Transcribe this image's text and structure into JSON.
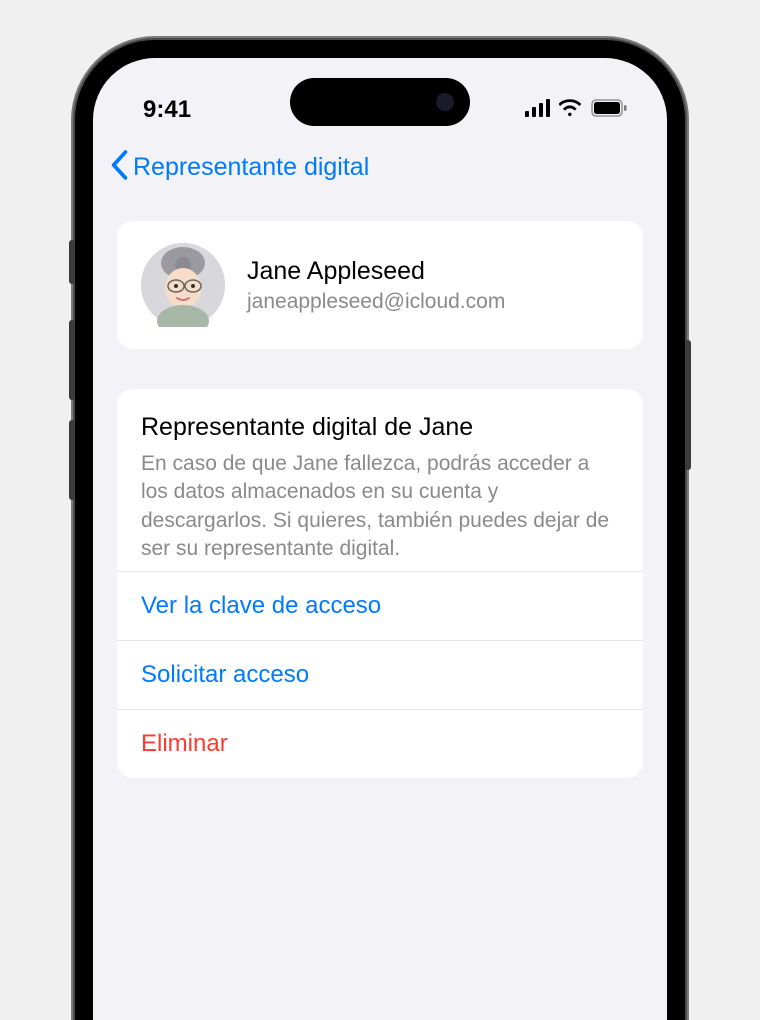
{
  "status": {
    "time": "9:41"
  },
  "nav": {
    "back_label": "Representante digital"
  },
  "contact": {
    "name": "Jane Appleseed",
    "email": "janeappleseed@icloud.com"
  },
  "section": {
    "title": "Representante digital de Jane",
    "description": "En caso de que Jane fallezca, podrás acceder a los datos almacenados en su cuenta y descargarlos. Si quieres, también puedes dejar de ser su representante digital."
  },
  "actions": {
    "view_key": "Ver la clave de acceso",
    "request_access": "Solicitar acceso",
    "remove": "Eliminar"
  }
}
